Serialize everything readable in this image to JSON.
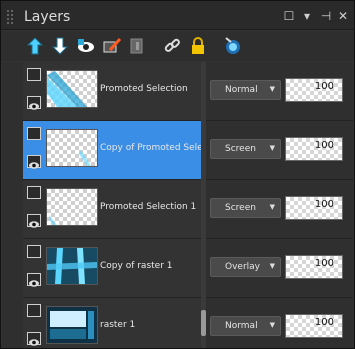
{
  "title": "Layers",
  "window_controls": {
    "restore": "☐",
    "menu": "▾",
    "pin": "⊣",
    "close": "✕"
  },
  "toolbar": [
    "new-raster-layer-icon",
    "new-vector-layer-icon",
    "show-hide-icon",
    "link-icon",
    "lock-icon",
    "mask-icon",
    "chain-link-icon",
    "padlock-icon",
    "layer-effects-icon"
  ],
  "layers": [
    {
      "name": "Promoted Selection",
      "blend": "Normal",
      "opacity": "100",
      "selected": false
    },
    {
      "name": "Copy of Promoted Selecti",
      "blend": "Screen",
      "opacity": "100",
      "selected": true
    },
    {
      "name": "Promoted Selection 1",
      "blend": "Screen",
      "opacity": "100",
      "selected": false
    },
    {
      "name": "Copy of raster 1",
      "blend": "Overlay",
      "opacity": "100",
      "selected": false
    },
    {
      "name": "raster 1",
      "blend": "Normal",
      "opacity": "100",
      "selected": false
    }
  ],
  "colors": {
    "selected": "#3a8ee6",
    "accent_cyan": "#4fd1ff"
  }
}
